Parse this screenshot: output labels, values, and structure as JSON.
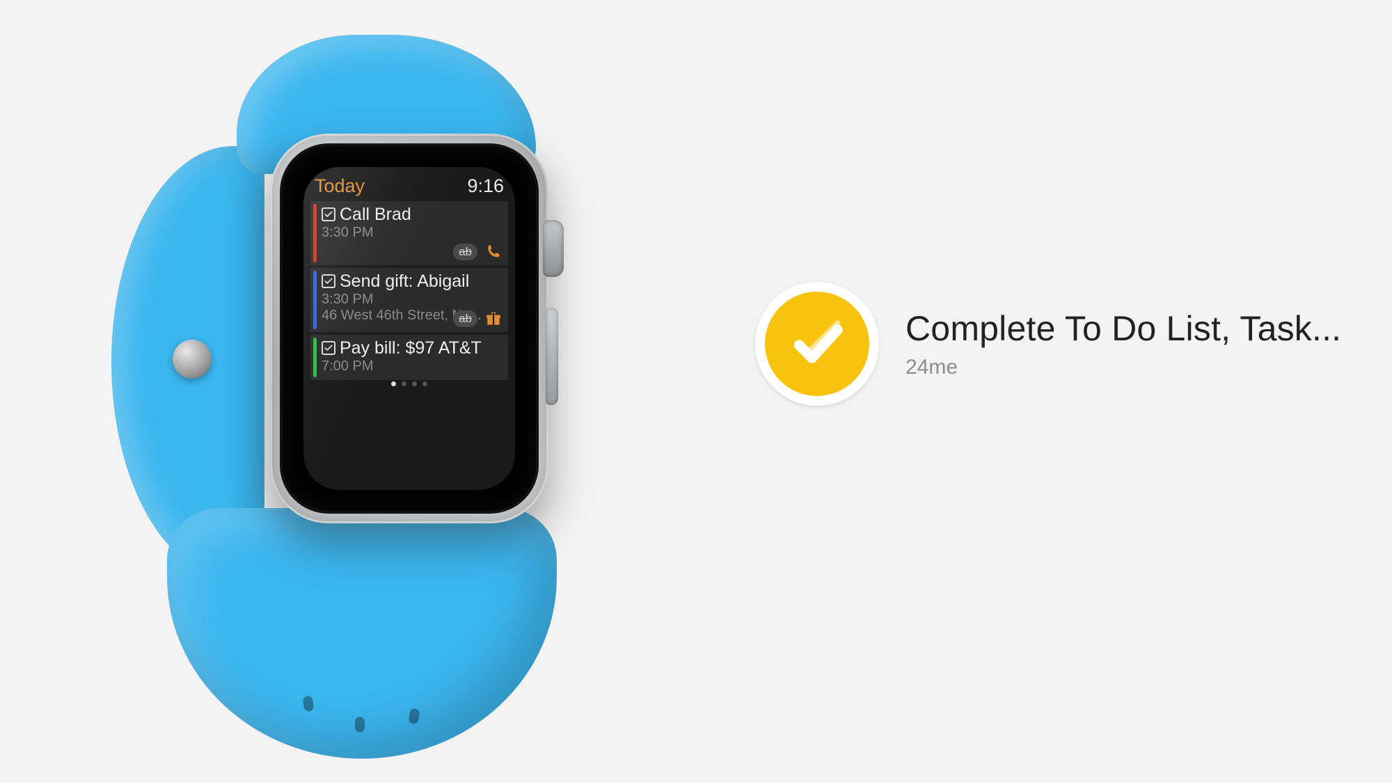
{
  "app_info": {
    "title": "Complete To Do List, Task...",
    "vendor": "24me",
    "icon_color": "#f7c30e"
  },
  "watch": {
    "header": {
      "title": "Today",
      "time": "9:16"
    },
    "pager": {
      "count": 4,
      "active_index": 0
    },
    "tasks": [
      {
        "stripe": "red",
        "checked": true,
        "title": "Call Brad",
        "time": "3:30 PM",
        "subtitle": "",
        "actions": [
          "strike",
          "phone"
        ]
      },
      {
        "stripe": "blue",
        "checked": true,
        "title": "Send gift: Abigail",
        "time": "3:30 PM",
        "subtitle": "46 West 46th Street, Ne...",
        "actions": [
          "strike",
          "gift"
        ]
      },
      {
        "stripe": "green",
        "checked": true,
        "title": "Pay bill: $97 AT&T",
        "time": "7:00 PM",
        "subtitle": "",
        "actions": []
      }
    ],
    "action_labels": {
      "strike": "ab"
    }
  }
}
